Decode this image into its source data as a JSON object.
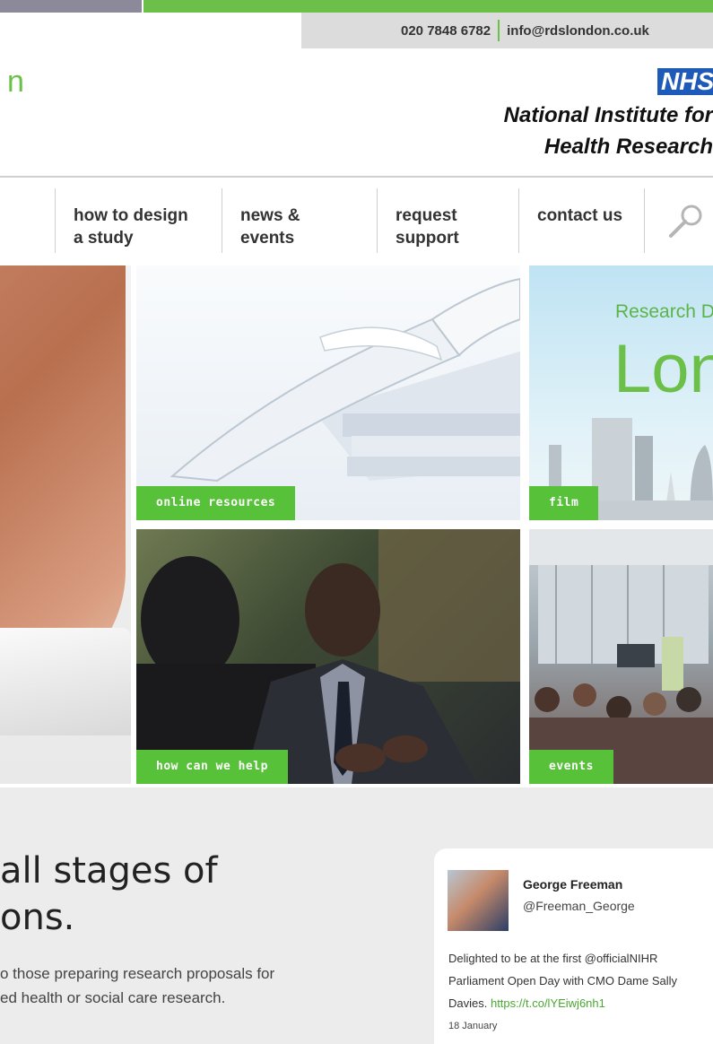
{
  "contact": {
    "phone": "020 7848 6782",
    "email": "info@rdslondon.co.uk"
  },
  "logo": {
    "fragment": "n"
  },
  "nihr": {
    "badge": "NHS",
    "line1": "National Institute for",
    "line2": "Health Research"
  },
  "nav": {
    "items": [
      {
        "label": ""
      },
      {
        "label": "how to design a study"
      },
      {
        "label": "news & events"
      },
      {
        "label": "request support"
      },
      {
        "label": "contact us"
      }
    ],
    "search_icon": "search-icon"
  },
  "tiles": {
    "online_resources": "online resources",
    "film": "film",
    "film_image_text1": "Research D",
    "film_image_text2": "Lon",
    "how_can_we_help": "how can we help",
    "events": "events"
  },
  "intro": {
    "headline_line1": " all stages of",
    "headline_line2": "ons.",
    "body_line1": "o those preparing research proposals for",
    "body_line2": "ed health or social care research."
  },
  "tweet": {
    "name": "George Freeman",
    "handle": "@Freeman_George",
    "text_line1": "Delighted to be at the first @officialNIHR",
    "text_line2": "Parliament Open Day with CMO Dame Sally",
    "text_line3_prefix": "Davies. ",
    "link": "https://t.co/lYEiwj6nh1",
    "date": "18 January"
  },
  "colors": {
    "accent_green": "#6cc04a",
    "tile_label_green": "#58c13a",
    "nhs_blue": "#1e5bb8",
    "top_grey": "#8c8a9a"
  }
}
